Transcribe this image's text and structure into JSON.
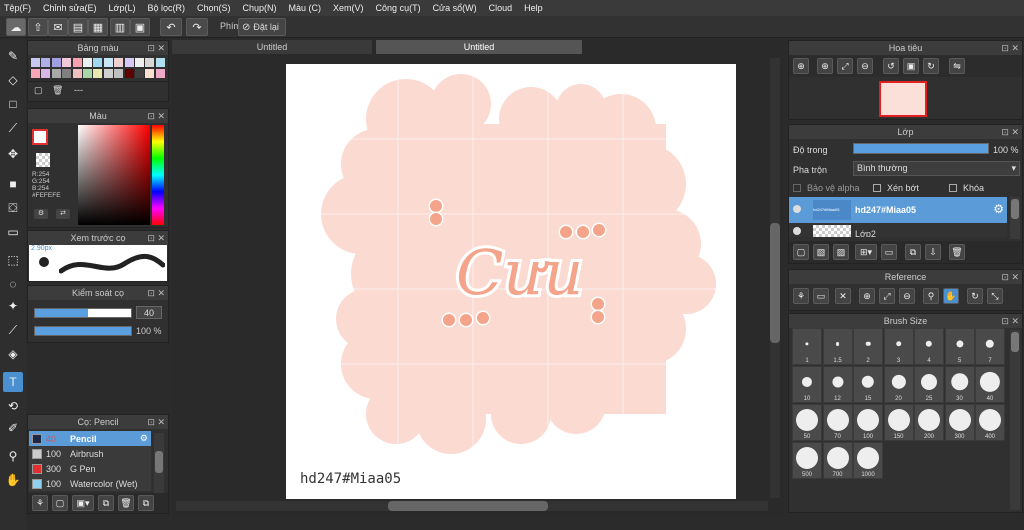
{
  "menu": [
    "Tệp(F)",
    "Chỉnh sửa(E)",
    "Lớp(L)",
    "Bộ lọc(R)",
    "Chọn(S)",
    "Chụp(N)",
    "Màu (C)",
    "Xem(V)",
    "Công cụ(T)",
    "Cửa sổ(W)",
    "Cloud",
    "Help"
  ],
  "toolbar": {
    "phim_label": "Phím",
    "reset_label": "Đặt lại"
  },
  "palette": {
    "title": "Bảng màu",
    "footer": "---",
    "colors": [
      "#c8c8f0",
      "#b0b0e8",
      "#a0a0e0",
      "#f0c8d8",
      "#f8a0b0",
      "#e8f0f0",
      "#a0d8f0",
      "#c8e8f8",
      "#f0d0d0",
      "#d8c8f8",
      "#f0f0f0",
      "#d8d8d8",
      "#b0e0f0",
      "#f8a8b8",
      "#d8b8e8",
      "#a8a8a8",
      "#808080",
      "#f0c0c0",
      "#a8d8a8",
      "#e8e8b0",
      "#d0d0d0",
      "#c0c0c0",
      "#600000",
      "#404040",
      "#f8e0d0",
      "#f0a8c8"
    ]
  },
  "color": {
    "title": "Màu",
    "r": "R:254",
    "g": "G:254",
    "b": "B:254",
    "hex": "#FEFEFE"
  },
  "preview": {
    "title": "Xem trước cọ",
    "size": "2.90px"
  },
  "brushctrl": {
    "title": "Kiểm soát cọ",
    "size": "40",
    "opacity": "100 %",
    "size_level": 0.55,
    "opacity_level": 1.0
  },
  "brushes": {
    "title": "Cọ: Pencil",
    "items": [
      {
        "num": "40",
        "name": "Pencil",
        "color": "#1e2a44",
        "sel": true
      },
      {
        "num": "100",
        "name": "Airbrush",
        "color": "#cccccc",
        "sel": false
      },
      {
        "num": "300",
        "name": "G Pen",
        "color": "#e03030",
        "sel": false
      },
      {
        "num": "100",
        "name": "Watercolor (Wet)",
        "color": "#8fd0f0",
        "sel": false
      }
    ]
  },
  "tabs": [
    "Untitled",
    "Untitled"
  ],
  "canvas_text": {
    "sticker": "Cưu",
    "watermark": "hd247#Miaa05"
  },
  "navigator": {
    "title": "Hoa tiêu"
  },
  "layers": {
    "title": "Lớp",
    "opacity_label": "Độ trong",
    "opacity_value": "100 %",
    "opacity_level": 1.0,
    "blend_label": "Pha trộn",
    "blend_value": "Bình thường",
    "protect_alpha": "Bảo vệ alpha",
    "clipping": "Xén bớt",
    "lock": "Khóa",
    "items": [
      {
        "name": "hd247#Miaa05",
        "thumb": "hd247#Miaa05",
        "sel": true
      },
      {
        "name": "Lớp2",
        "sel": false
      }
    ]
  },
  "reference": {
    "title": "Reference"
  },
  "brushsize": {
    "title": "Brush Size",
    "sizes": [
      "1",
      "1.5",
      "2",
      "3",
      "4",
      "5",
      "7",
      "10",
      "12",
      "15",
      "20",
      "25",
      "30",
      "40",
      "50",
      "70",
      "100",
      "150",
      "200",
      "300",
      "400",
      "500",
      "700",
      "1000"
    ]
  }
}
